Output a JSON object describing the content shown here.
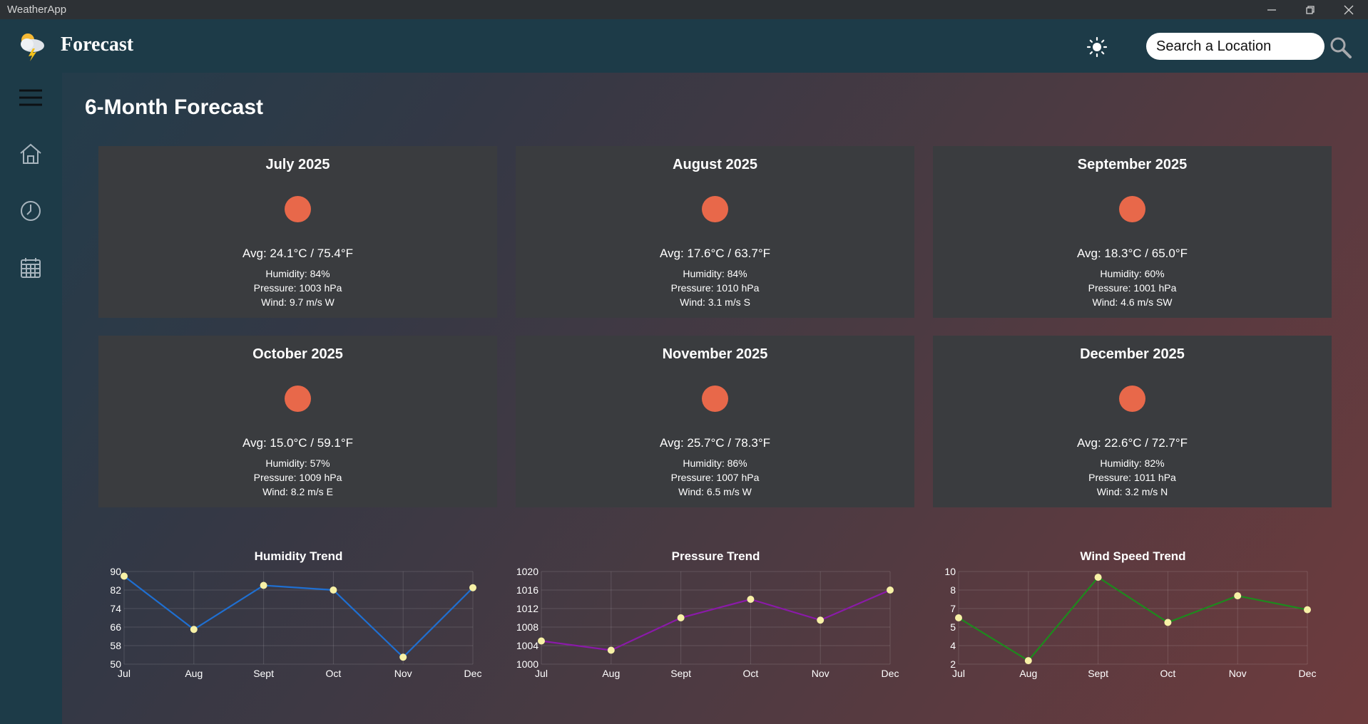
{
  "window": {
    "title": "WeatherApp"
  },
  "header": {
    "brand": "Forecast",
    "search_placeholder": "Search a Location"
  },
  "sidebar": {
    "items": [
      "menu-icon",
      "home-icon",
      "clock-icon",
      "calendar-icon"
    ]
  },
  "page": {
    "title": "6-Month Forecast"
  },
  "colors": {
    "sun": "#e8684a",
    "card_bg": "#3a3c3f",
    "header_bg": "#1d3b48",
    "point": "#f7f1a6"
  },
  "months": [
    {
      "title": "July 2025",
      "avg": "Avg: 24.1°C / 75.4°F",
      "humidity": "Humidity: 84%",
      "pressure": "Pressure: 1003 hPa",
      "wind": "Wind: 9.7 m/s W"
    },
    {
      "title": "August 2025",
      "avg": "Avg: 17.6°C / 63.7°F",
      "humidity": "Humidity: 84%",
      "pressure": "Pressure: 1010 hPa",
      "wind": "Wind: 3.1 m/s S"
    },
    {
      "title": "September 2025",
      "avg": "Avg: 18.3°C / 65.0°F",
      "humidity": "Humidity: 60%",
      "pressure": "Pressure: 1001 hPa",
      "wind": "Wind: 4.6 m/s SW"
    },
    {
      "title": "October 2025",
      "avg": "Avg: 15.0°C / 59.1°F",
      "humidity": "Humidity: 57%",
      "pressure": "Pressure: 1009 hPa",
      "wind": "Wind: 8.2 m/s E"
    },
    {
      "title": "November 2025",
      "avg": "Avg: 25.7°C / 78.3°F",
      "humidity": "Humidity: 86%",
      "pressure": "Pressure: 1007 hPa",
      "wind": "Wind: 6.5 m/s W"
    },
    {
      "title": "December 2025",
      "avg": "Avg: 22.6°C / 72.7°F",
      "humidity": "Humidity: 82%",
      "pressure": "Pressure: 1011 hPa",
      "wind": "Wind: 3.2 m/s N"
    }
  ],
  "chart_data": [
    {
      "type": "line",
      "title": "Humidity Trend",
      "categories": [
        "Jul",
        "Aug",
        "Sept",
        "Oct",
        "Nov",
        "Dec"
      ],
      "values": [
        88,
        65,
        84,
        82,
        53,
        83
      ],
      "yticks": [
        50,
        58,
        66,
        74,
        82,
        90
      ],
      "ylim": [
        50,
        90
      ],
      "color": "#1f6fd1",
      "grid": true
    },
    {
      "type": "line",
      "title": "Pressure Trend",
      "categories": [
        "Jul",
        "Aug",
        "Sept",
        "Oct",
        "Nov",
        "Dec"
      ],
      "values": [
        1005,
        1003,
        1010,
        1014,
        1009.5,
        1016
      ],
      "yticks": [
        1000,
        1004,
        1008,
        1012,
        1016,
        1020
      ],
      "ylim": [
        1000,
        1020
      ],
      "color": "#8a1aa8",
      "grid": true
    },
    {
      "type": "line",
      "title": "Wind Speed Trend",
      "categories": [
        "Jul",
        "Aug",
        "Sept",
        "Oct",
        "Nov",
        "Dec"
      ],
      "values": [
        6,
        2.3,
        9.5,
        5.6,
        7.9,
        6.7
      ],
      "yticks": [
        "2",
        "4",
        "5",
        "7",
        "8",
        "10"
      ],
      "ylim": [
        2,
        10
      ],
      "color": "#1d8a1d",
      "grid": true
    }
  ]
}
